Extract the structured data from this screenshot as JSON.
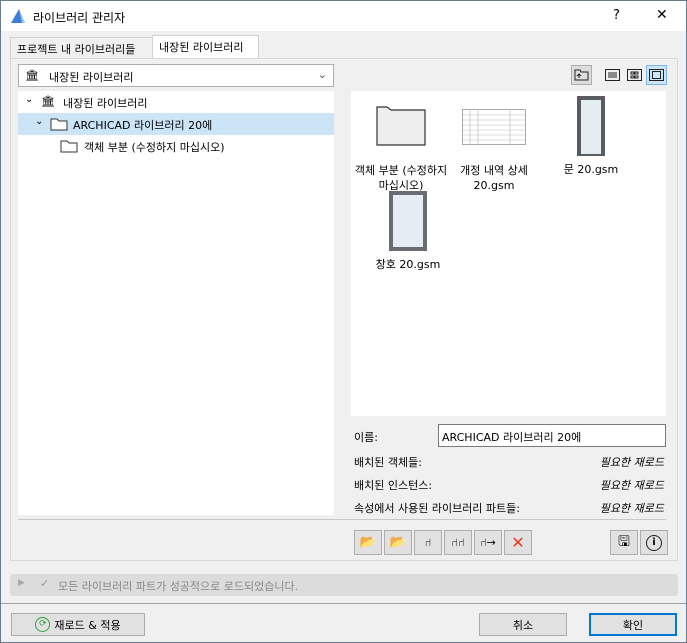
{
  "window": {
    "title": "라이브러리 관리자",
    "help": "?",
    "close": "✕"
  },
  "tabs": [
    {
      "label": "프로젝트 내 라이브러리들"
    },
    {
      "label": "내장된 라이브러리"
    }
  ],
  "dropdown": {
    "value": "내장된 라이브러리"
  },
  "tree": [
    {
      "label": "내장된 라이브러리"
    },
    {
      "label": "ARCHICAD 라이브러리 20에"
    },
    {
      "label": "객체 부분 (수정하지 마십시오)"
    }
  ],
  "preview_items": [
    {
      "label": "객체 부분 (수정하지 마십시오)"
    },
    {
      "label": "개정 내역 상세 20.gsm"
    },
    {
      "label": "문 20.gsm"
    },
    {
      "label": "창호 20.gsm"
    }
  ],
  "info": {
    "name_label": "이름:",
    "name_value": "ARCHICAD 라이브러리 20에",
    "rows": [
      {
        "label": "배치된 객체들:",
        "value": "필요한 재로드"
      },
      {
        "label": "배치된 인스턴스:",
        "value": "필요한 재로드"
      },
      {
        "label": "속성에서 사용된 라이브러리 파트들:",
        "value": "필요한 재로드"
      }
    ]
  },
  "status": {
    "message": "모든 라이브러리 파트가 성공적으로 로드되었습니다."
  },
  "footer": {
    "reload": "재로드 & 적용",
    "cancel": "취소",
    "ok": "확인"
  }
}
